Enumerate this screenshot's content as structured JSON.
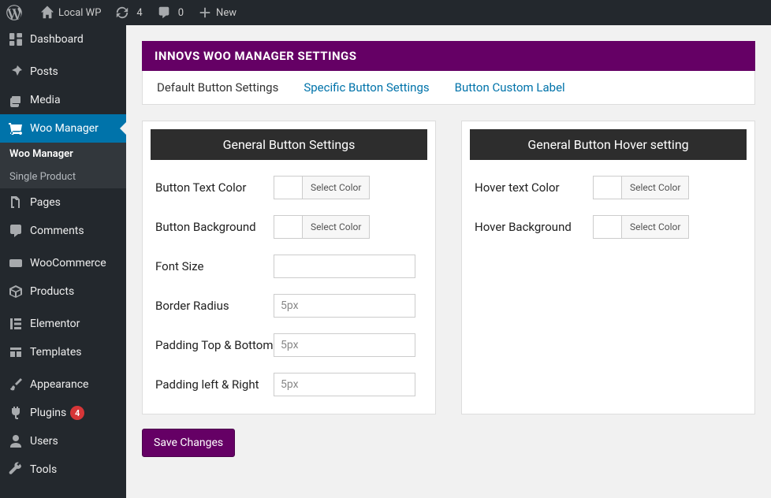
{
  "adminbar": {
    "site_name": "Local WP",
    "updates_count": "4",
    "comments_count": "0",
    "new_label": "New"
  },
  "sidebar": {
    "items": [
      {
        "label": "Dashboard"
      },
      {
        "label": "Posts"
      },
      {
        "label": "Media"
      },
      {
        "label": "Woo Manager"
      },
      {
        "label": "Pages"
      },
      {
        "label": "Comments"
      },
      {
        "label": "WooCommerce"
      },
      {
        "label": "Products"
      },
      {
        "label": "Elementor"
      },
      {
        "label": "Templates"
      },
      {
        "label": "Appearance"
      },
      {
        "label": "Plugins"
      },
      {
        "label": "Users"
      },
      {
        "label": "Tools"
      }
    ],
    "sub": {
      "items": [
        {
          "label": "Woo Manager"
        },
        {
          "label": "Single Product"
        }
      ]
    },
    "plugins_count": "4"
  },
  "page": {
    "title": "INNOVS WOO MANAGER SETTINGS",
    "tabs": [
      {
        "label": "Default Button Settings"
      },
      {
        "label": "Specific Button Settings"
      },
      {
        "label": "Button Custom Label"
      }
    ],
    "panel_left": {
      "heading": "General Button Settings",
      "fields": {
        "text_color": {
          "label": "Button Text Color",
          "btn": "Select Color"
        },
        "background": {
          "label": "Button Background",
          "btn": "Select Color"
        },
        "font_size": {
          "label": "Font Size",
          "placeholder": ""
        },
        "border_radius": {
          "label": "Border Radius",
          "placeholder": "5px"
        },
        "padding_tb": {
          "label": "Padding Top & Bottom",
          "placeholder": "5px"
        },
        "padding_lr": {
          "label": "Padding left & Right",
          "placeholder": "5px"
        }
      }
    },
    "panel_right": {
      "heading": "General Button Hover setting",
      "fields": {
        "hover_text": {
          "label": "Hover text Color",
          "btn": "Select Color"
        },
        "hover_bg": {
          "label": "Hover Background",
          "btn": "Select Color"
        }
      }
    },
    "save_label": "Save Changes"
  }
}
